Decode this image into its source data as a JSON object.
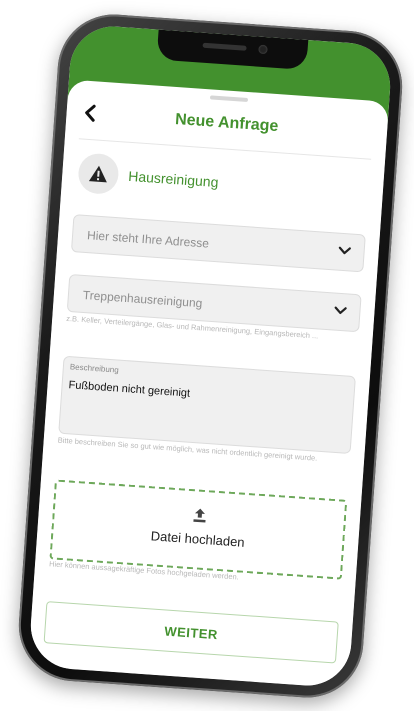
{
  "header": {
    "back_icon": "chevron-left-icon",
    "title": "Neue Anfrage"
  },
  "category": {
    "icon": "warning-triangle-icon",
    "label": "Hausreinigung"
  },
  "address_select": {
    "placeholder": "Hier steht Ihre Adresse",
    "icon": "chevron-down-icon"
  },
  "service_select": {
    "value": "Treppenhausreinigung",
    "icon": "chevron-down-icon",
    "hint": "z.B. Keller, Verteilergänge, Glas- und Rahmenreinigung, Eingangsbereich ..."
  },
  "description": {
    "label": "Beschreibung",
    "value": "Fußboden nicht gereinigt",
    "hint": "Bitte beschreiben Sie so gut wie möglich, was nicht ordentlich gereinigt wurde."
  },
  "upload": {
    "icon": "upload-icon",
    "label": "Datei hochladen",
    "hint": "Hier können aussagekräftige Fotos hochgeladen werden."
  },
  "submit": {
    "label": "WEITER"
  },
  "colors": {
    "brand_green": "#43912e",
    "dashed_border": "#6da85a"
  }
}
